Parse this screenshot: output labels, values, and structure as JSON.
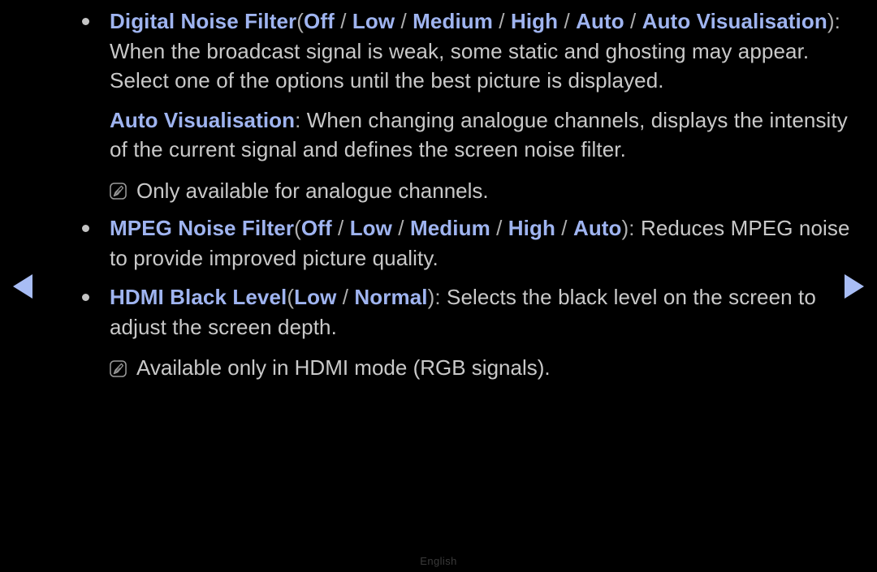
{
  "screen": {
    "background_color": "#000000",
    "body_text_color": "#C9C9C9",
    "highlight_color": "#9FB4F0",
    "separator_color": "#AFAFAF"
  },
  "nav": {
    "prev_icon": "triangle-left-icon",
    "next_icon": "triangle-right-icon",
    "arrow_color": "#A8BDF5"
  },
  "sections": [
    {
      "id": "digital-noise-filter",
      "type": "bullet",
      "term": "Digital Noise Filter",
      "open_paren": "(",
      "options": [
        "Off",
        "Low",
        "Medium",
        "High",
        "Auto",
        "Auto Visualisation"
      ],
      "option_separator": " / ",
      "close_paren": "):",
      "lines": [
        "When the broadcast signal is weak, some static and ghosting may appear.",
        "Select one of the options until the best picture is displayed."
      ]
    },
    {
      "id": "auto-visualisation",
      "type": "plain",
      "term": "Auto Visualisation",
      "term_suffix": ":",
      "lines": [
        " When changing analogue channels, displays the intensity",
        "of the current signal and defines the screen noise filter."
      ]
    },
    {
      "id": "note-analogue",
      "type": "note",
      "icon": "note-pen-icon",
      "text": "Only available for analogue channels."
    },
    {
      "id": "mpeg-noise-filter",
      "type": "bullet",
      "term": "MPEG Noise Filter",
      "open_paren": "(",
      "options": [
        "Off",
        "Low",
        "Medium",
        "High",
        "Auto"
      ],
      "option_separator": " / ",
      "close_paren": "):",
      "trailing_body": " Reduces MPEG noise",
      "lines": [
        "to provide improved picture quality."
      ]
    },
    {
      "id": "hdmi-black-level",
      "type": "bullet",
      "term": "HDMI Black Level",
      "open_paren": "(",
      "options": [
        "Low",
        "Normal"
      ],
      "option_separator": " / ",
      "close_paren": "):",
      "trailing_body": " Selects the black level on the screen to",
      "lines": [
        "adjust the screen depth."
      ]
    },
    {
      "id": "note-hdmi",
      "type": "note",
      "icon": "note-pen-icon",
      "text": "Available only in HDMI mode (RGB signals)."
    }
  ],
  "footer": {
    "language": "English"
  }
}
